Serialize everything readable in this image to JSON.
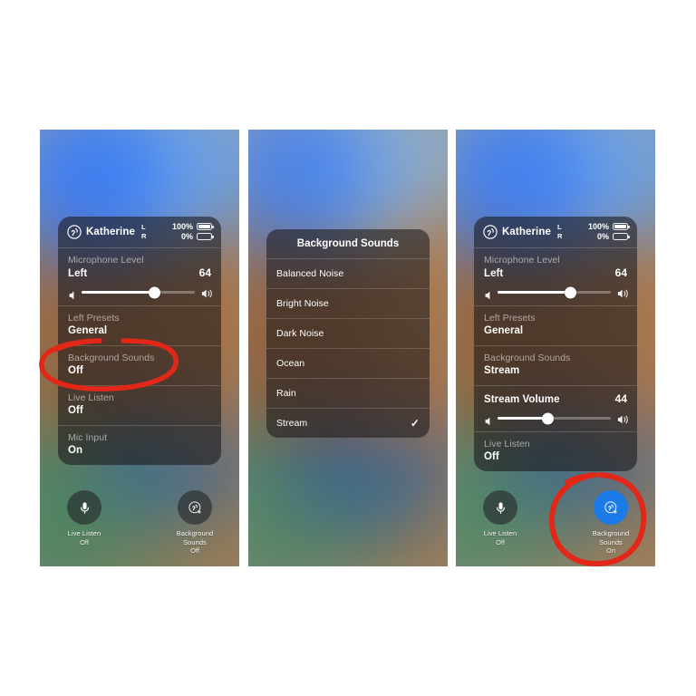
{
  "meta": {
    "scene": "iOS hearing-device Control Center panels, three screenshots side by side",
    "accent_blue": "#1a7ae8",
    "annotation_red": "#e02718"
  },
  "panels": [
    {
      "id": "panel-1",
      "device": {
        "name": "Katherine",
        "channel_left": "L",
        "channel_right": "R",
        "battery_left": "100%",
        "battery_right": "0%",
        "battery_left_pct": 100,
        "battery_right_pct": 0
      },
      "rows": [
        {
          "label": "Microphone Level",
          "value": "Left",
          "number": "64",
          "slider": 64
        },
        {
          "label": "Left Presets",
          "value": "General"
        },
        {
          "label": "Background Sounds",
          "value": "Off"
        },
        {
          "label": "Live Listen",
          "value": "Off"
        },
        {
          "label": "Mic Input",
          "value": "On"
        }
      ],
      "actions": [
        {
          "icon": "microphone-icon",
          "title": "Live Listen",
          "state": "Off",
          "active": false
        },
        {
          "icon": "background-sounds-icon",
          "title_line1": "Background",
          "title_line2": "Sounds",
          "state": "Off",
          "active": false
        }
      ],
      "annotation": "red-ellipse-around-background-sounds-row"
    },
    {
      "id": "panel-2",
      "menu": {
        "title": "Background Sounds",
        "items": [
          {
            "label": "Balanced Noise",
            "selected": false
          },
          {
            "label": "Bright Noise",
            "selected": false
          },
          {
            "label": "Dark Noise",
            "selected": false
          },
          {
            "label": "Ocean",
            "selected": false
          },
          {
            "label": "Rain",
            "selected": false
          },
          {
            "label": "Stream",
            "selected": true
          }
        ],
        "checkmark": "✓"
      }
    },
    {
      "id": "panel-3",
      "device": {
        "name": "Katherine",
        "channel_left": "L",
        "channel_right": "R",
        "battery_left": "100%",
        "battery_right": "0%",
        "battery_left_pct": 100,
        "battery_right_pct": 0
      },
      "rows": [
        {
          "label": "Microphone Level",
          "value": "Left",
          "number": "64",
          "slider": 64
        },
        {
          "label": "Left Presets",
          "value": "General"
        },
        {
          "label": "Background Sounds",
          "value": "Stream"
        },
        {
          "label": "Stream Volume",
          "number": "44",
          "slider": 44
        },
        {
          "label": "Live Listen",
          "value": "Off"
        }
      ],
      "actions": [
        {
          "icon": "microphone-icon",
          "title": "Live Listen",
          "state": "Off",
          "active": false
        },
        {
          "icon": "background-sounds-icon",
          "title_line1": "Background",
          "title_line2": "Sounds",
          "state": "On",
          "active": true
        }
      ],
      "annotation": "red-circle-around-background-sounds-button"
    }
  ]
}
